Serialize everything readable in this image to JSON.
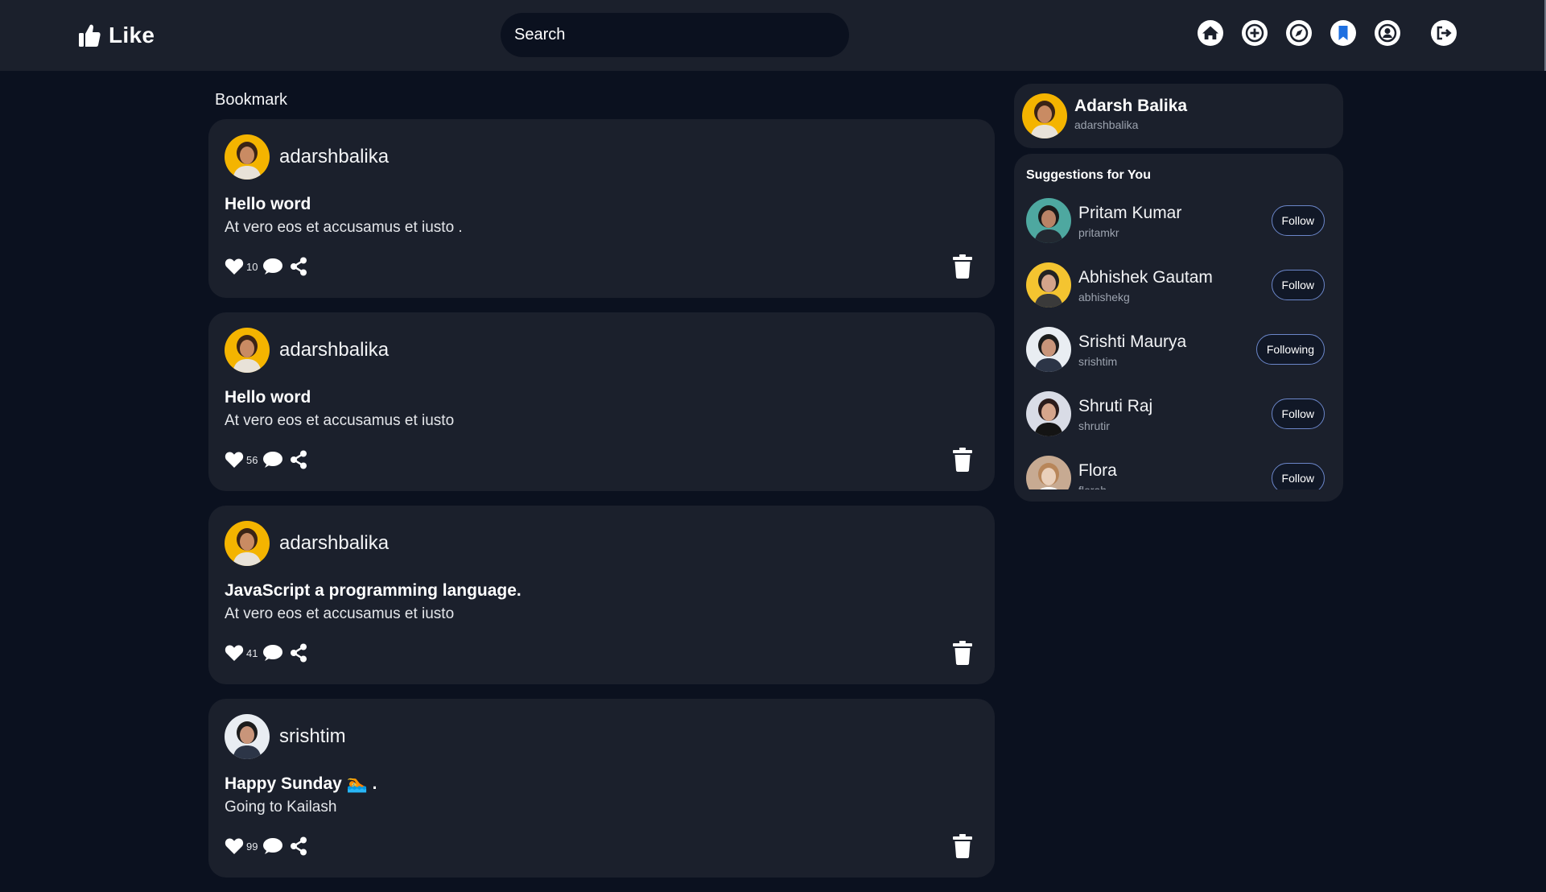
{
  "app": {
    "logo_text": "Like"
  },
  "search": {
    "placeholder": "Search"
  },
  "nav": [
    {
      "name": "home-icon"
    },
    {
      "name": "add-post-icon"
    },
    {
      "name": "explore-icon"
    },
    {
      "name": "bookmark-icon",
      "active": true
    },
    {
      "name": "profile-icon"
    },
    {
      "name": "logout-icon"
    }
  ],
  "page": {
    "title": "Bookmark"
  },
  "posts": [
    {
      "username": "adarshbalika",
      "title": "Hello word",
      "body": "At vero eos et accusamus et iusto .",
      "likes": "10",
      "avatar": "adarsh"
    },
    {
      "username": "adarshbalika",
      "title": "Hello word",
      "body": "At vero eos et accusamus et iusto",
      "likes": "56",
      "avatar": "adarsh"
    },
    {
      "username": "adarshbalika",
      "title": "JavaScript a programming language.",
      "body": "At vero eos et accusamus et iusto",
      "likes": "41",
      "avatar": "adarsh"
    },
    {
      "username": "srishtim",
      "title": "Happy Sunday 🏊 .",
      "body": "Going to Kailash",
      "likes": "99",
      "avatar": "srishti"
    }
  ],
  "profile": {
    "name": "Adarsh Balika",
    "handle": "adarshbalika"
  },
  "suggestions": {
    "heading": "Suggestions for You",
    "users": [
      {
        "name": "Pritam Kumar",
        "handle": "pritamkr",
        "button": "Follow",
        "avatar": "pritam"
      },
      {
        "name": "Abhishek Gautam",
        "handle": "abhishekg",
        "button": "Follow",
        "avatar": "abhishek"
      },
      {
        "name": "Srishti Maurya",
        "handle": "srishtim",
        "button": "Following",
        "avatar": "srishti"
      },
      {
        "name": "Shruti Raj",
        "handle": "shrutir",
        "button": "Follow",
        "avatar": "shruti"
      },
      {
        "name": "Flora",
        "handle": "florah",
        "button": "Follow",
        "avatar": "flora"
      }
    ]
  },
  "colors": {
    "background": "#0b111f",
    "card": "#1b202c",
    "bookmark_active": "#1d6fe0",
    "button_border": "#6b86c9"
  }
}
